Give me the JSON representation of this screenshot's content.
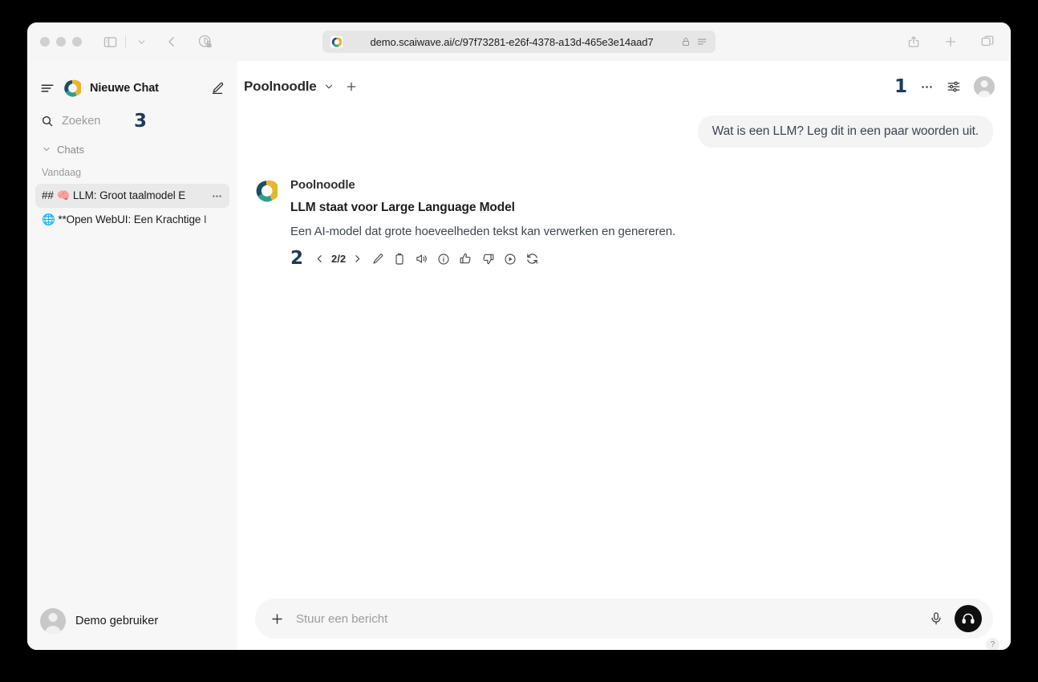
{
  "browser": {
    "url": "demo.scaiwave.ai/c/97f73281-e26f-4378-a13d-465e3e14aad7",
    "icons": {
      "sidebar_toggle": "sidebar-toggle-icon",
      "tab_overview": "chevron-down-icon",
      "back": "back-arrow-icon",
      "privacy": "privacy-shield-lock-icon",
      "lock": "lock-icon",
      "reader": "reader-view-icon",
      "share": "share-icon",
      "new_tab": "plus-icon",
      "tabs": "tab-overview-icon"
    }
  },
  "sidebar": {
    "title": "Nieuwe Chat",
    "menu_icon": "hamburger-icon",
    "edit_icon": "edit-pencil-square-icon",
    "search": {
      "placeholder": "Zoeken",
      "icon": "search-icon",
      "annotation": "3"
    },
    "section": {
      "label": "Chats",
      "chevron": "chevron-down-icon"
    },
    "day_label": "Vandaag",
    "chats": [
      {
        "emoji": "🧠",
        "prefix": "## ",
        "label": "## 🧠 LLM: Groot taalmodel E",
        "text": "LLM: Groot taalmodel E",
        "active": true,
        "more_icon": "more-horizontal-icon"
      },
      {
        "emoji": "🌐",
        "prefix": "",
        "label": "🌐 **Open WebUI: Een Krachtige I",
        "text": "**Open WebUI: Een Krachtige I",
        "active": false,
        "more_icon": "more-horizontal-icon"
      }
    ],
    "user": {
      "name": "Demo gebruiker",
      "avatar": "user-avatar"
    }
  },
  "header": {
    "model_name": "Poolnoodle",
    "model_chevron": "chevron-down-icon",
    "add_model": "plus-icon",
    "annotation": "1",
    "more_icon": "more-horizontal-icon",
    "controls_icon": "sliders-controls-icon",
    "avatar": "user-avatar"
  },
  "conversation": {
    "user_message": "Wat is een LLM? Leg dit in een paar woorden uit.",
    "assistant": {
      "name": "Poolnoodle",
      "avatar": "poolnoodle-logo",
      "heading": "LLM staat voor Large Language Model",
      "text": "Een AI-model dat grote hoeveelheden tekst kan verwerken en genereren."
    },
    "actions": {
      "annotation": "2",
      "prev_icon": "chevron-left-icon",
      "page_count": "2/2",
      "next_icon": "chevron-right-icon",
      "items": [
        {
          "icon": "edit-pencil-icon",
          "name": "edit"
        },
        {
          "icon": "copy-clipboard-icon",
          "name": "copy"
        },
        {
          "icon": "speaker-read-aloud-icon",
          "name": "read-aloud"
        },
        {
          "icon": "info-circle-icon",
          "name": "info"
        },
        {
          "icon": "thumbs-up-icon",
          "name": "good-response"
        },
        {
          "icon": "thumbs-down-icon",
          "name": "bad-response"
        },
        {
          "icon": "play-circle-icon",
          "name": "continue-response"
        },
        {
          "icon": "refresh-regenerate-icon",
          "name": "regenerate"
        }
      ]
    }
  },
  "composer": {
    "plus_icon": "plus-icon",
    "placeholder": "Stuur een bericht",
    "value": "",
    "mic_icon": "microphone-icon",
    "call_icon": "headphones-icon",
    "help": "?"
  },
  "colors": {
    "sidebar_bg": "#f7f7f7",
    "active_item": "#e9e9e9",
    "bubble_bg": "#f4f4f5",
    "annotation": "#1c3a5e",
    "call_button": "#0f0f0f",
    "logo_navy": "#1b4d6b",
    "logo_teal": "#2e9e8f",
    "logo_gold": "#e8b62c"
  }
}
